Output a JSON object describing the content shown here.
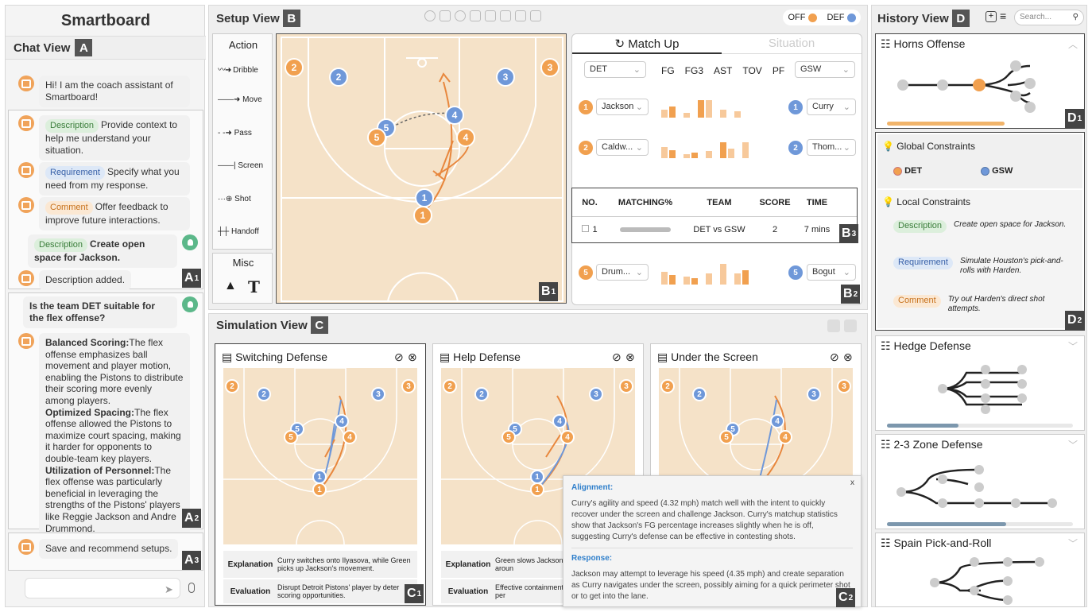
{
  "left": {
    "title": "Smartboard",
    "chat_title": "Chat View",
    "chat_tag": "A",
    "welcome": "Hi! I am the coach assistant of Smartboard!",
    "msgs": [
      {
        "pill": "Description",
        "text": "Provide context to help me understand your situation."
      },
      {
        "pill": "Requirement",
        "text": "Specify what you need from my response."
      },
      {
        "pill": "Comment",
        "text": "Offer feedback to improve future interactions."
      }
    ],
    "user_pill": "Description",
    "user_text": "Create open space for Jackson.",
    "added": "Description added.",
    "a1": "A",
    "a1s": "1",
    "question": "Is the team DET suitable for the flex offense?",
    "answer": [
      {
        "h": "Balanced Scoring:",
        "t": "The flex offense emphasizes ball movement and player motion, enabling the Pistons to distribute their scoring more evenly among players."
      },
      {
        "h": "Optimized Spacing:",
        "t": "The flex offense allowed the Pistons to maximize court spacing, making it harder for opponents to double-team key players."
      },
      {
        "h": "Utilization of Personnel:",
        "t": "The flex offense was particularly beneficial in leveraging the strengths of the Pistons' players like Reggie Jackson and Andre Drummond."
      }
    ],
    "a2": "A",
    "a2s": "2",
    "save": "Save and recommend setups.",
    "a3": "A",
    "a3s": "3"
  },
  "setup": {
    "title": "Setup View",
    "tag": "B",
    "off": "OFF",
    "def": "DEF",
    "action_title": "Action",
    "actions": [
      "Dribble",
      "Move",
      "Pass",
      "Screen",
      "Shot",
      "Handoff"
    ],
    "misc_title": "Misc",
    "b1": "B",
    "b1s": "1",
    "b2": "B",
    "b2s": "2",
    "b3": "B",
    "b3s": "3",
    "matchup_tab": "Match Up",
    "situation_tab": "Situation",
    "team_left": "DET",
    "team_right": "GSW",
    "stats": [
      "FG",
      "FG3",
      "AST",
      "TOV",
      "PF"
    ],
    "rows": [
      {
        "n": "1",
        "left": "Jackson",
        "right": "Curry"
      },
      {
        "n": "2",
        "left": "Caldw...",
        "right": "Thom..."
      },
      {
        "n": "5",
        "left": "Drum...",
        "right": "Bogut"
      }
    ],
    "table_headers": [
      "NO.",
      "MATCHING%",
      "TEAM",
      "SCORE",
      "TIME"
    ],
    "table_row": {
      "no": "1",
      "team": "DET vs GSW",
      "score": "2",
      "time": "7 mins"
    },
    "players_off": [
      "1",
      "2",
      "3",
      "4",
      "5"
    ],
    "players_def": [
      "1",
      "2",
      "3",
      "4",
      "5"
    ]
  },
  "sim": {
    "title": "Simulation View",
    "tag": "C",
    "cards": [
      {
        "title": "Switching Defense",
        "exp_label": "Explanation",
        "exp": "Curry switches onto Ilyasova, while Green picks up Jackson's movement.",
        "eval_label": "Evaluation",
        "eval": "Disrupt Detroit Pistons' player by deter scoring opportunities."
      },
      {
        "title": "Help Defense",
        "exp_label": "Explanation",
        "exp": "Green slows Jackson, Curry recovers aroun",
        "eval_label": "Evaluation",
        "eval": "Effective containment while maintaining per"
      },
      {
        "title": "Under the Screen"
      }
    ],
    "c1": "C",
    "c1s": "1",
    "c2": "C",
    "c2s": "2",
    "popup": {
      "close": "x",
      "align_title": "Alignment:",
      "align": "Curry's agility and speed (4.32 mph) match well with the intent to quickly recover under the screen and challenge Jackson. Curry's matchup statistics show that Jackson's FG percentage increases slightly when he is off, suggesting Curry's defense can be effective in contesting shots.",
      "resp_title": "Response:",
      "resp": "Jackson may attempt to leverage his speed (4.35 mph) and create separation as Curry navigates under the screen, possibly aiming for a quick perimeter shot or to get into the lane."
    }
  },
  "history": {
    "title": "History View",
    "tag": "D",
    "search": "Search...",
    "items": [
      "Horns Offense",
      "Hedge Defense",
      "2-3 Zone Defense",
      "Spain Pick-and-Roll"
    ],
    "d1": "D",
    "d1s": "1",
    "d2": "D",
    "d2s": "2",
    "global": "Global Constraints",
    "local": "Local Constraints",
    "teams": [
      "DET",
      "GSW"
    ],
    "constraints": [
      {
        "pill": "Description",
        "text": "Create open space for Jackson."
      },
      {
        "pill": "Requirement",
        "text": "Simulate Houston's pick-and-rolls with Harden."
      },
      {
        "pill": "Comment",
        "text": "Try out Harden's direct shot attempts."
      }
    ]
  }
}
